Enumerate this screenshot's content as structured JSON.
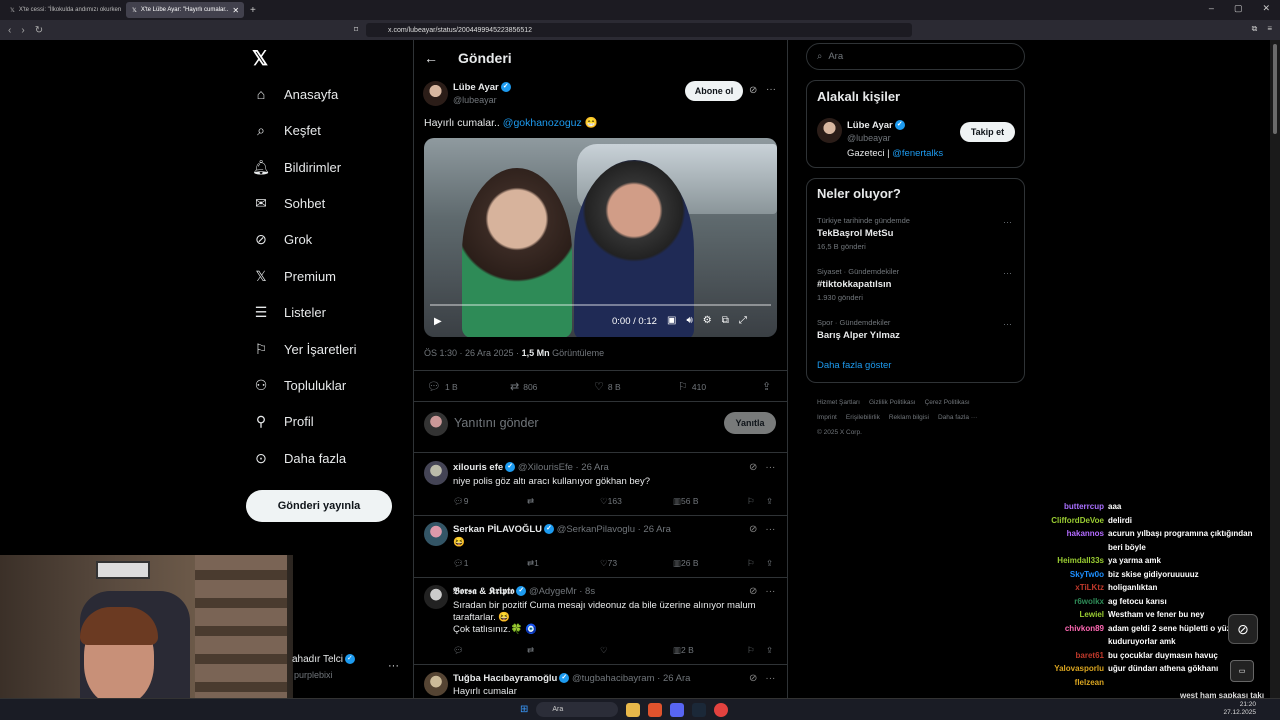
{
  "browser": {
    "tabs": [
      {
        "label": "X'te cessi: \"İlkokulda andımızı okurken",
        "active": false
      },
      {
        "label": "X'te Lübe Ayar: \"Hayırlı cumalar..",
        "active": true
      }
    ],
    "url": "x.com/lubeayar/status/2004499945223856512"
  },
  "nav": {
    "items": [
      {
        "label": "Anasayfa",
        "icon": "home-icon"
      },
      {
        "label": "Keşfet",
        "icon": "search-icon"
      },
      {
        "label": "Bildirimler",
        "icon": "bell-icon"
      },
      {
        "label": "Sohbet",
        "icon": "mail-icon"
      },
      {
        "label": "Grok",
        "icon": "grok-icon"
      },
      {
        "label": "Premium",
        "icon": "x-icon"
      },
      {
        "label": "Listeler",
        "icon": "list-icon"
      },
      {
        "label": "Yer İşaretleri",
        "icon": "bookmark-icon"
      },
      {
        "label": "Topluluklar",
        "icon": "people-icon"
      },
      {
        "label": "Profil",
        "icon": "person-icon"
      },
      {
        "label": "Daha fazla",
        "icon": "more-circle-icon"
      }
    ],
    "post_button": "Gönderi yayınla",
    "account_name": "ahadır Telci",
    "account_handle": "purplebixi"
  },
  "header": {
    "title": "Gönderi"
  },
  "tweet": {
    "author_name": "Lübe Ayar",
    "author_handle": "@lubeayar",
    "subscribe_label": "Abone ol",
    "text": "Hayırlı cumalar..",
    "mention": "@gokhanozoguz",
    "emoji": "😁",
    "video_time": "0:00 / 0:12",
    "video_progress": 0,
    "time": "ÖS 1:30 · 26 Ara 2025 · ",
    "views": "1,5 Mn",
    "views_label": " Görüntüleme",
    "stats": {
      "replies": "1 B",
      "retweets": "806",
      "likes": "8 B",
      "bookmarks": "410"
    }
  },
  "reply_box": {
    "placeholder": "Yanıtını gönder",
    "button": "Yanıtla"
  },
  "replies": [
    {
      "name": "xilouris efe",
      "handle": "@XilourisEfe · 26 Ara",
      "text": "niye polis göz altı aracı kullanıyor gökhan bey?",
      "replies": "9",
      "retweets": "",
      "likes": "163",
      "views": "56 B"
    },
    {
      "name": "Serkan PİLAVOĞLU",
      "handle": "@SerkanPilavoglu · 26 Ara",
      "text": "😆",
      "replies": "1",
      "retweets": "1",
      "likes": "73",
      "views": "26 B"
    },
    {
      "name": "𝕭𝖔𝖗𝖘𝖆 & 𝕶𝖗𝖎𝖕𝖙𝖔",
      "handle": "@AdygeMr · 8s",
      "text": "Sıradan bir pozitif Cuma mesajı videonuz da bile üzerine alınıyor malum taraftarlar. 😆",
      "text2": "Çok tatlısınız.🍀 🧿",
      "replies": "",
      "retweets": "",
      "likes": "",
      "views": "2 B"
    },
    {
      "name": "Tuğba Hacıbayramoğlu",
      "handle": "@tugbahacibayram · 26 Ara",
      "text": "Hayırlı cumalar"
    }
  ],
  "right": {
    "search_placeholder": "Ara",
    "related_title": "Alakalı kişiler",
    "related": {
      "name": "Lübe Ayar",
      "handle": "@lubeayar",
      "bio": "Gazeteci | ",
      "bio_mention": "@fenertalks",
      "follow": "Takip et"
    },
    "trends_title": "Neler oluyor?",
    "trends": [
      {
        "context": "Türkiye tarihinde gündemde",
        "name": "TekBaşrol MetSu",
        "count": "16,5 B gönderi"
      },
      {
        "context": "Siyaset · Gündemdekiler",
        "name": "#tiktokkapatılsın",
        "count": "1.930 gönderi"
      },
      {
        "context": "Spor · Gündemdekiler",
        "name": "Barış Alper Yılmaz",
        "count": ""
      }
    ],
    "show_more": "Daha fazla göster",
    "footer": [
      "Hizmet Şartları",
      "Gizlilik Politikası",
      "Çerez Politikası",
      "Imprint",
      "Erişilebilirlik",
      "Reklam bilgisi",
      "Daha fazla ···",
      "© 2025 X Corp."
    ]
  },
  "chat": [
    {
      "user": "butterrcup",
      "msg": "aaa",
      "color": "#a970ff"
    },
    {
      "user": "CliffordDeVoe",
      "msg": "delirdi",
      "color": "#9acd32"
    },
    {
      "user": "hakannos",
      "msg": "acurun yılbaşı programına çıktığından beri böyle",
      "color": "#b36bff"
    },
    {
      "user": "Heimdall33s",
      "msg": "ya yarma amk",
      "color": "#9acd32"
    },
    {
      "user": "SkyTw0o",
      "msg": "biz skise gidiyoruuuuuz",
      "color": "#1e90ff"
    },
    {
      "user": "xTiLKtz",
      "msg": "holiganlıktan",
      "color": "#c0392b"
    },
    {
      "user": "r6wolkx",
      "msg": "ag fetocu karısı",
      "color": "#2e8b57"
    },
    {
      "user": "Lewiel",
      "msg": "Westham ve fener bu ney",
      "color": "#9acd32"
    },
    {
      "user": "chivkon89",
      "msg": "adam geldi 2 sene hüpletti o yüzden kuduruyorlar amk",
      "color": "#ff69b4"
    },
    {
      "user": "baret61",
      "msg": "bu çocuklar duymasın havuç",
      "color": "#c0392b"
    },
    {
      "user": "Yalovasporlu",
      "msg": "uğur dündarı athena gökhanı",
      "color": "#daa520"
    },
    {
      "user": "flelzean",
      "msg": "",
      "color": "#daa520"
    }
  ],
  "overlay_text": "west ham şapkası takı neydi kardeşim",
  "taskbar": {
    "search": "Ara",
    "time": "21:20",
    "date": "27.12.2025"
  }
}
